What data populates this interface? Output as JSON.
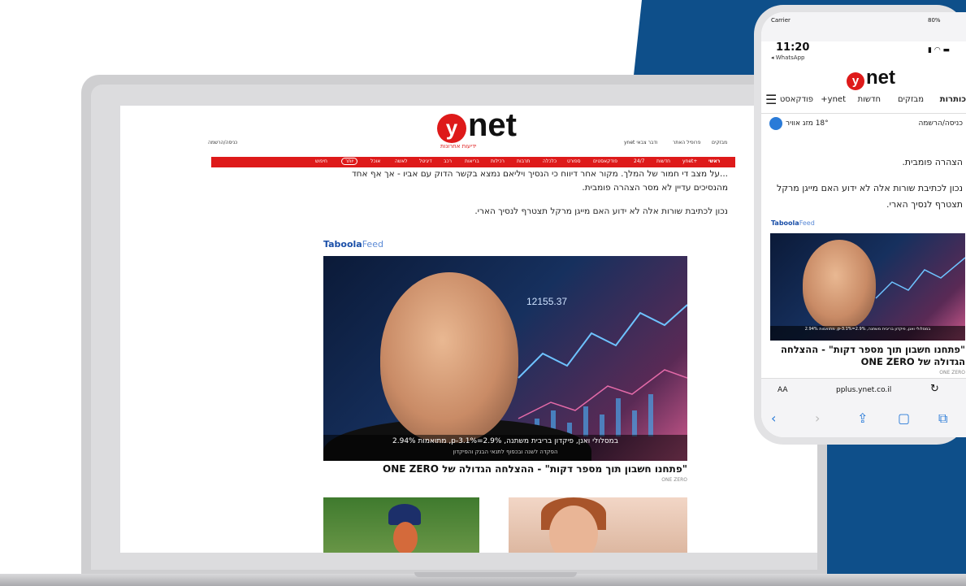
{
  "colors": {
    "brand_red": "#de1a1a",
    "ios_blue": "#2a7bd8",
    "background_navy": "#0e4f8a"
  },
  "desktop": {
    "logo_sub": "ידיעות אחרונות",
    "logo_text": "net",
    "logo_letter": "y",
    "top_left_login": "כניסה/הרשמה",
    "top_right": [
      "מבזקים",
      "פרופיל האתר",
      "ynet ודבר צבאי"
    ],
    "nav": [
      "ראשי",
      "ynet+",
      "חדשות",
      "24/7",
      "פודקאסטים",
      "ספורט",
      "כלכלה",
      "תרבות",
      "רכילות",
      "בריאות",
      "רכב",
      "דיגיטל",
      "לאשה",
      "אוכל",
      "יותר",
      "חיפוש"
    ],
    "article_para1": "...על מצב די חמור של המלך. מקור אחר דיווח כי הנסיך ויליאם נמצא בקשר הדוק עם אביו - אך אף אחד מהנסיכים עדיין לא מסר הצהרה פומבית.",
    "article_para2": "נכון לכתיבת שורות אלה לא ידוע האם מייגן מרקל תצטרף לנסיך הארי.",
    "taboola_brand": "Taboola",
    "taboola_feed": "Feed",
    "hero_caption_1": "במסלולי ואנן, פיקדון בריבית משתנה, 2.9%=p-3.1%, מתואמות 2.94%",
    "hero_caption_2": "הפקדה לשנה ובכפוף לתנאי הבנק והפיקדון",
    "hero_number": "12155.37",
    "headline": "\"פתחנו חשבון תוך מספר דקות\" - ההצלחה הגדולה של ONE ZERO",
    "source": "ONE ZERO"
  },
  "phone": {
    "carrier": "Carrier",
    "time": "11:20",
    "back_app": "◂ WhatsApp",
    "battery": "80%",
    "logo_letter": "y",
    "logo_text": "net",
    "nav": [
      "כותרות",
      "מבזקים",
      "חדשות",
      "ynet+",
      "פודקאסט"
    ],
    "login": "כניסה/הרשמה",
    "weather": "18° מזג אוויר",
    "article_line1": "הצהרה פומבית.",
    "article_line2": "נכון לכתיבת שורות אלה לא ידוע האם מייגן מרקל תצטרף לנסיך הארי.",
    "taboola_brand": "Taboola",
    "taboola_feed": "Feed",
    "hero_caption": "במסלולי ואנן, פיקדון בריבית משתנה, 2.9%=p-3.1%, מתואמות 2.94%",
    "headline": "\"פתחנו חשבון תוך מספר דקות\" - ההצלחה הגדולה של ONE ZERO",
    "source": "ONE ZERO",
    "url_aa": "AA",
    "url": "pplus.ynet.co.il"
  }
}
